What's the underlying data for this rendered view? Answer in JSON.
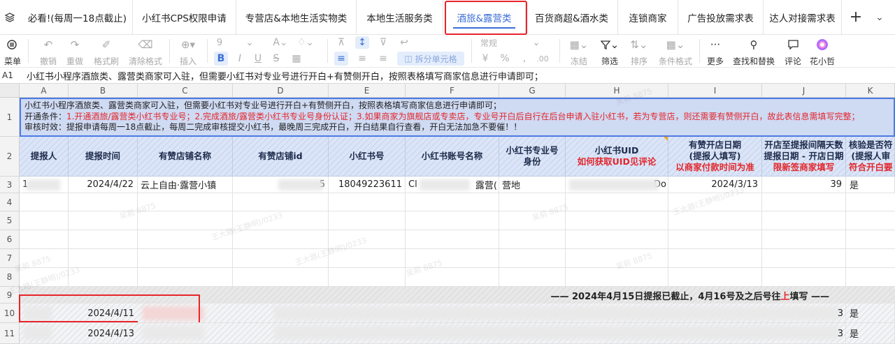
{
  "tabs": [
    {
      "label": "必看!(每周一18点截止)",
      "active": false
    },
    {
      "label": "小红书CPS权限申请",
      "active": false
    },
    {
      "label": "专营店&本地生活实物类",
      "active": false
    },
    {
      "label": "本地生活服务类",
      "active": false
    },
    {
      "label": "酒旅&露营类",
      "active": true
    },
    {
      "label": "百货商超&酒水类",
      "active": false
    },
    {
      "label": "连锁商家",
      "active": false
    },
    {
      "label": "广告投放需求表",
      "active": false
    },
    {
      "label": "达人对接需求表",
      "active": false
    }
  ],
  "tab_add_symbol": "+",
  "toolbar": {
    "menu_label": "菜单",
    "undo_label": "撤销",
    "redo_label": "重做",
    "format_painter_label": "格式刷",
    "clear_format_label": "清除格式",
    "insert_label": "插入",
    "font_size": "9",
    "merge_label": "拆分单元格",
    "number_format": "常规",
    "freeze_label": "冻结",
    "filter_label": "筛选",
    "sort_label": "排序",
    "conditional_label": "条件格式",
    "more_label": "更多",
    "find_replace_label": "查找和替换",
    "comment_label": "评论",
    "assistant_label": "花小哲"
  },
  "formula_bar": {
    "cell_ref": "A1",
    "content": "小红书小程序酒旅类、露营类商家可入驻，但需要小红书对专业号进行开白+有赞侧开白，按照表格填写商家信息进行申请即可；"
  },
  "columns": [
    "A",
    "B",
    "C",
    "D",
    "E",
    "F",
    "G",
    "H",
    "I",
    "J",
    "K"
  ],
  "rows": [
    "1",
    "2",
    "3",
    "4",
    "5",
    "6",
    "7",
    "8",
    "9",
    "10",
    "11"
  ],
  "notice": {
    "line1": "小红书小程序酒旅类、露营类商家可入驻，但需要小红书对专业号进行开白+有赞侧开白，按照表格填写商家信息进行申请即可；",
    "line2_prefix": "开通条件：",
    "line2_red": "1.开通酒旅/露营类小红书专业号；2.完成酒旅/露营类小红书专业号身份认证；3.如果商家为旗舰店或专卖店，专业号开白后自行在后台申请入驻小红书，若为专营店，则还需要有赞侧开白，故此表信息需填写完整；",
    "line3": "审核时效：提报申请每周一18点截止，每周二完成审核提交小红书，最晚周三完成开白，开白结果自行查看，开白无法加急不要催！！"
  },
  "headers": [
    {
      "title": "提报人",
      "sub": ""
    },
    {
      "title": "提报时间",
      "sub": ""
    },
    {
      "title": "有赞店铺名称",
      "sub": ""
    },
    {
      "title": "有赞店铺id",
      "sub": ""
    },
    {
      "title": "小红书号",
      "sub": ""
    },
    {
      "title": "小红书账号名称",
      "sub": ""
    },
    {
      "title": "小红书专业号身份",
      "sub": ""
    },
    {
      "title": "小红书UID",
      "sub": "如何获取UID见评论"
    },
    {
      "title": "有赞开店日期\n(提报人填写)",
      "sub": "以商家付款时间为准"
    },
    {
      "title": "开店至提报间隔天数\n提报日期 - 开店日期",
      "sub": "限新签商家填写"
    },
    {
      "title": "核验是否符\n(提报人审",
      "sub": "符合开白要"
    }
  ],
  "row3": {
    "a": "1",
    "b": "2024/4/22",
    "c": "云上自由·露营小镇",
    "d": "5",
    "e": "18049223611",
    "f_start": "Cl",
    "f_end": "露营(",
    "g": "营地",
    "h_end": "Do",
    "i": "2024/3/13",
    "j": "39",
    "k": "是"
  },
  "band_text_prefix": "——  2024年4月15日提报已截止，4月16号及之后号往",
  "band_text_red": "上",
  "band_text_suffix": "填写  ——",
  "row10": {
    "b": "2024/4/11",
    "j_end": "3",
    "k": "是"
  },
  "row11": {
    "b": "2024/4/13",
    "j_end": "3",
    "k": "是"
  },
  "watermarks": [
    "吴前 8875",
    "王大路(王静明)/0233"
  ]
}
